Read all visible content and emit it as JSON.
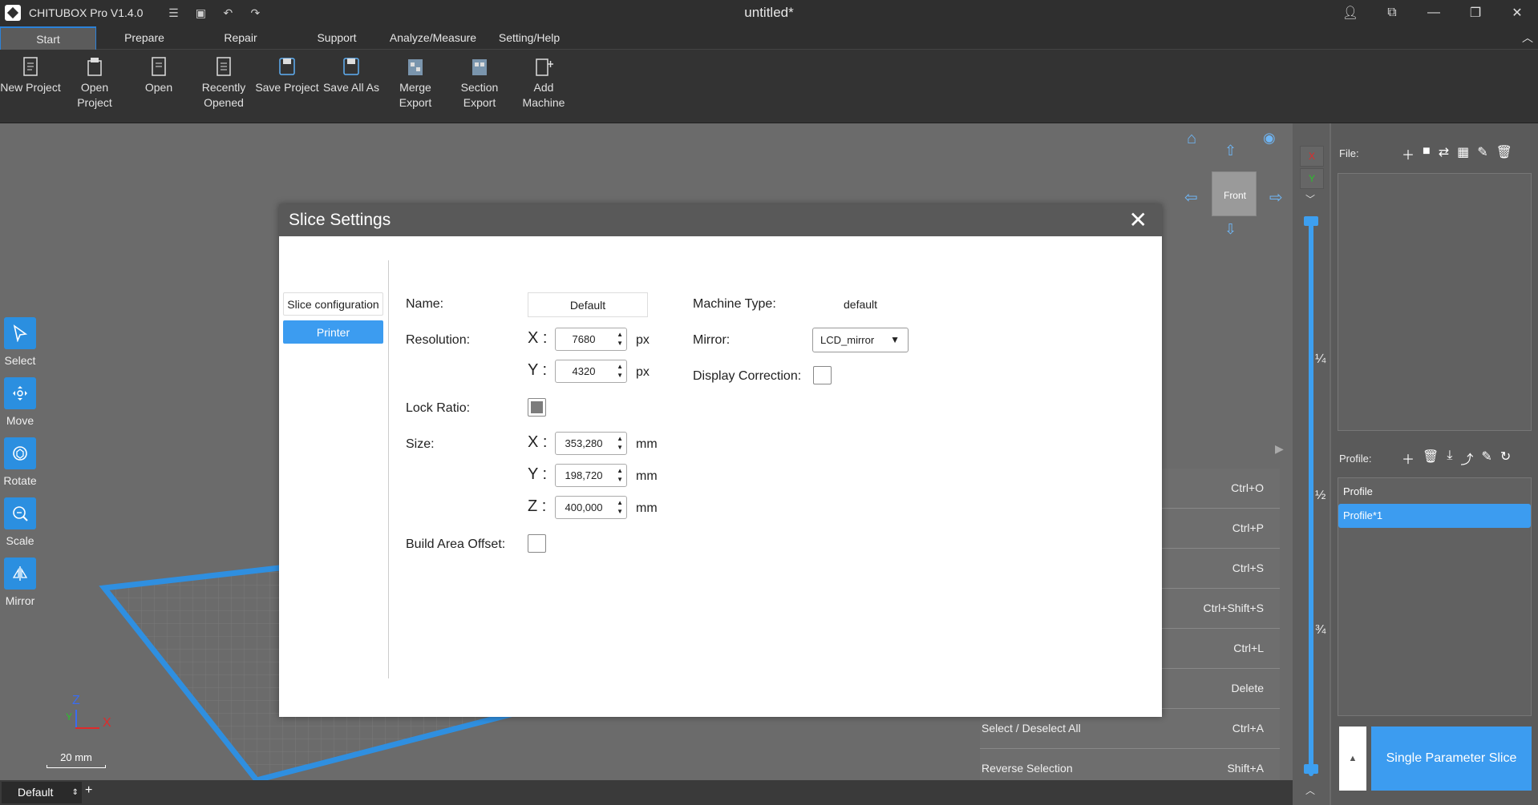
{
  "app": {
    "name": "CHITUBOX Pro V1.4.0",
    "document_title": "untitled*"
  },
  "menu": {
    "tabs": [
      {
        "label": "Start",
        "active": true
      },
      {
        "label": "Prepare"
      },
      {
        "label": "Repair"
      },
      {
        "label": "Support"
      },
      {
        "label": "Analyze/Measure"
      },
      {
        "label": "Setting/Help"
      }
    ]
  },
  "ribbon": {
    "buttons": [
      {
        "label": "New Project",
        "icon": "new-project-icon"
      },
      {
        "label": "Open\nProject",
        "icon": "open-project-icon"
      },
      {
        "label": "Open",
        "icon": "open-file-icon"
      },
      {
        "label": "Recently\nOpened",
        "icon": "recent-icon"
      },
      {
        "label": "Save Project",
        "icon": "save-icon"
      },
      {
        "label": "Save All As",
        "icon": "save-all-icon"
      },
      {
        "label": "Merge\nExport",
        "icon": "merge-export-icon"
      },
      {
        "label": "Section\nExport",
        "icon": "section-export-icon"
      },
      {
        "label": "Add\nMachine",
        "icon": "add-machine-icon"
      }
    ]
  },
  "tools": [
    {
      "label": "Select",
      "icon": "select-cursor-icon"
    },
    {
      "label": "Move",
      "icon": "move-icon"
    },
    {
      "label": "Rotate",
      "icon": "rotate-icon"
    },
    {
      "label": "Scale",
      "icon": "scale-icon"
    },
    {
      "label": "Mirror",
      "icon": "mirror-icon"
    }
  ],
  "viewport": {
    "axis_z": "Z",
    "axis_x": "X",
    "axis_y": "Y",
    "scale_label": "20 mm",
    "cube_face": "Front"
  },
  "shortcuts": [
    {
      "label": "",
      "key": "Ctrl+O"
    },
    {
      "label": "",
      "key": "Ctrl+P"
    },
    {
      "label": "",
      "key": "Ctrl+S"
    },
    {
      "label": "",
      "key": "Ctrl+Shift+S"
    },
    {
      "label": "",
      "key": "Ctrl+L"
    },
    {
      "label": "",
      "key": "Delete"
    },
    {
      "label": "Select / Deselect All",
      "key": "Ctrl+A"
    },
    {
      "label": "Reverse Selection",
      "key": "Shift+A"
    }
  ],
  "dialog": {
    "title": "Slice Settings",
    "side_tabs": [
      {
        "label": "Slice configuration",
        "active": false
      },
      {
        "label": "Printer",
        "active": true
      }
    ],
    "name_label": "Name:",
    "name_value": "Default",
    "resolution_label": "Resolution:",
    "res_x_label": "X :",
    "res_x": "7680",
    "res_y_label": "Y :",
    "res_y": "4320",
    "px_unit": "px",
    "lock_ratio_label": "Lock Ratio:",
    "lock_ratio_checked": true,
    "size_label": "Size:",
    "size_x_label": "X :",
    "size_x": "353,280",
    "size_y_label": "Y :",
    "size_y": "198,720",
    "size_z_label": "Z :",
    "size_z": "400,000",
    "mm_unit": "mm",
    "build_area_offset_label": "Build Area Offset:",
    "build_area_offset_checked": false,
    "machine_type_label": "Machine Type:",
    "machine_type_value": "default",
    "mirror_label": "Mirror:",
    "mirror_value": "LCD_mirror",
    "display_correction_label": "Display Correction:",
    "display_correction_checked": false
  },
  "layer_slider": {
    "axis_x": "X",
    "axis_y": "Y",
    "fractions": [
      "¼",
      "½",
      "¾"
    ]
  },
  "right_panel": {
    "file_label": "File:",
    "profile_label": "Profile:",
    "profiles": [
      {
        "name": "Profile",
        "selected": false
      },
      {
        "name": "Profile*1",
        "selected": true
      }
    ],
    "slice_button": "Single Parameter Slice"
  },
  "bottom": {
    "tab": "Default"
  }
}
